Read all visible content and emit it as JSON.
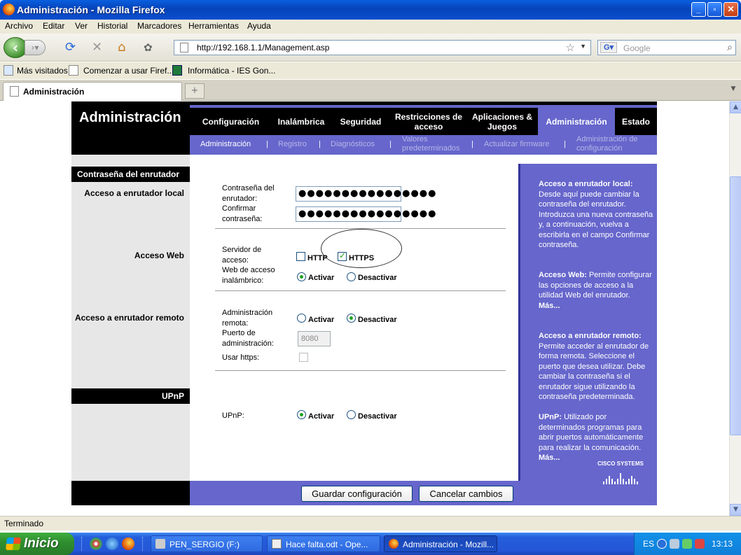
{
  "window": {
    "title": "Administración - Mozilla Firefox",
    "minimize": "_",
    "maximize": "▫",
    "close": "✕"
  },
  "menu": [
    "Archivo",
    "Editar",
    "Ver",
    "Historial",
    "Marcadores",
    "Herramientas",
    "Ayuda"
  ],
  "nav": {
    "url": "http://192.168.1.1/Management.asp",
    "search_placeholder": "Google"
  },
  "bookmarks": [
    "Más visitados",
    "Comenzar a usar Firef...",
    "Informática - IES Gon..."
  ],
  "tab": {
    "label": "Administración",
    "newtab": "+"
  },
  "router": {
    "page_title": "Administración",
    "tabs": [
      {
        "label": "Configuración"
      },
      {
        "label": "Inalámbrica"
      },
      {
        "label": "Seguridad"
      },
      {
        "label": "Restricciones de acceso"
      },
      {
        "label": "Aplicaciones & Juegos"
      },
      {
        "label": "Administración"
      },
      {
        "label": "Estado"
      }
    ],
    "subtabs": [
      "Administración",
      "Registro",
      "Diagnósticos",
      "Valores predeterminados",
      "Actualizar firmware",
      "Administración de configuración"
    ],
    "subtab_sep": "|",
    "sections": {
      "router_password": "Contraseña del enrutador",
      "upnp": "UPnP"
    },
    "side_labels": {
      "local": "Acceso a enrutador local",
      "web": "Acceso Web",
      "remote": "Acceso a enrutador remoto"
    },
    "fields": {
      "password_label": "Contraseña del enrutador:",
      "password_value": "●●●●●●●●●●●●●●●●",
      "confirm_label": "Confirmar contraseña:",
      "confirm_value": "●●●●●●●●●●●●●●●●",
      "server_label": "Servidor de acceso:",
      "http": "HTTP",
      "https": "HTTPS",
      "wireless_label": "Web de acceso inalámbrico:",
      "activate": "Activar",
      "deactivate": "Desactivar",
      "remote_admin_label": "Administración remota:",
      "port_label": "Puerto de administración:",
      "port_value": "8080",
      "use_https_label": "Usar https:",
      "upnp_label": "UPnP:"
    },
    "state": {
      "http_checked": false,
      "https_checked": true,
      "wireless_web": "Activar",
      "remote_admin": "Desactivar",
      "use_https_checked": false,
      "upnp": "Activar"
    },
    "help": {
      "local_title": "Acceso a enrutador local:",
      "local_text": "Desde aquí puede cambiar la contraseña del enrutador. Introduzca una nueva contraseña y, a continuación, vuelva a escribirla en el campo Confirmar contraseña.",
      "web_title": "Acceso Web:",
      "web_text": "Permite configurar las opciones de acceso a la utilidad Web del enrutador.",
      "web_more": "Más...",
      "remote_title": "Acceso a enrutador remoto:",
      "remote_text": "Permite acceder al enrutador de forma remota. Seleccione el puerto que desea utilizar. Debe cambiar la contraseña si el enrutador sigue utilizando la contraseña predeterminada.",
      "upnp_title": "UPnP:",
      "upnp_text": "Utilizado por determinados programas para abrir puertos automáticamente para realizar la comunicación.",
      "upnp_more": "Más..."
    },
    "buttons": {
      "save": "Guardar configuración",
      "cancel": "Cancelar cambios"
    },
    "brand": "Cisco Systems"
  },
  "status": "Terminado",
  "taskbar": {
    "start": "Inicio",
    "items": [
      "PEN_SERGIO (F:)",
      "Hace falta.odt - Ope...",
      "Administración - Mozill..."
    ],
    "lang": "ES",
    "clock": "13:13"
  },
  "colors": {
    "router_purple": "#6666cc",
    "router_dark_purple": "#333399",
    "xp_blue": "#245edb",
    "check_green": "#21a121"
  }
}
